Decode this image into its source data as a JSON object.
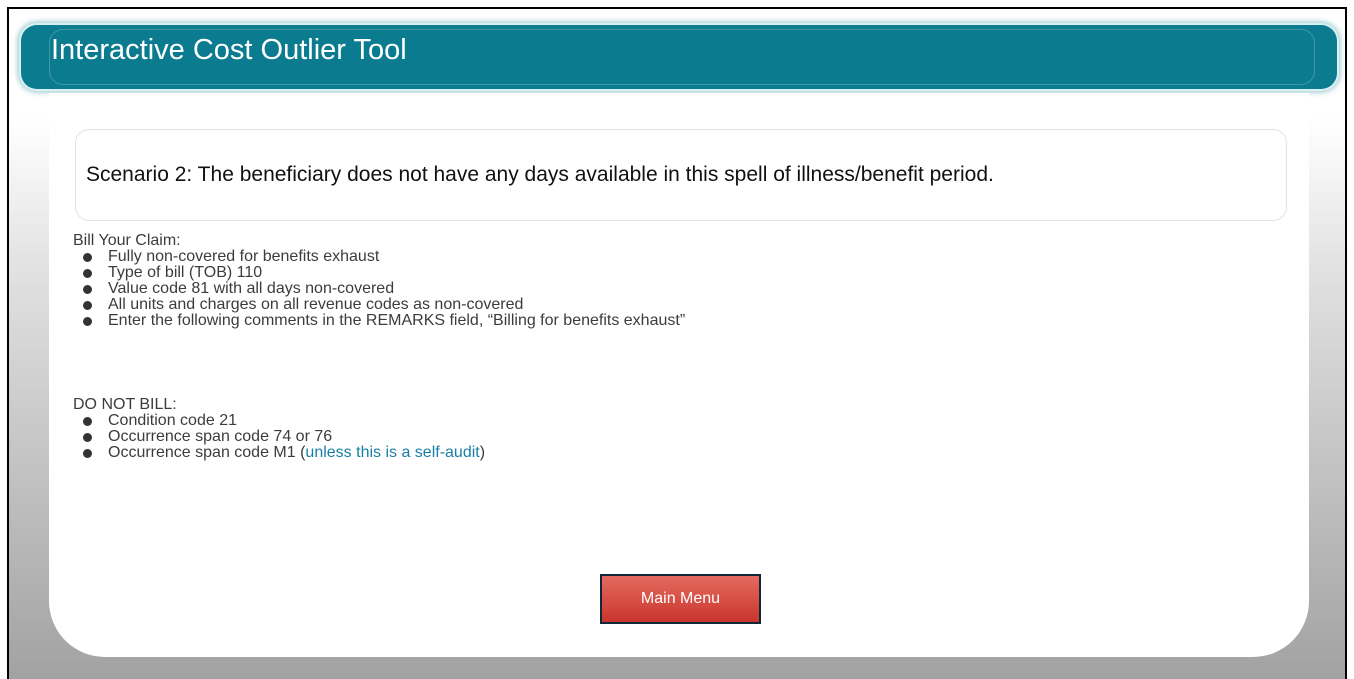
{
  "header": {
    "title": "Interactive Cost Outlier Tool"
  },
  "scenario": {
    "text": "Scenario 2: The beneficiary does not have any days available in this spell of illness/benefit period."
  },
  "bill_claim": {
    "heading": "Bill Your Claim:",
    "items": [
      "Fully non-covered for benefits exhaust",
      "Type of bill (TOB) 110",
      "Value code 81 with all days non-covered",
      "All units and charges on all revenue codes as non-covered",
      "Enter the following comments in the REMARKS field, “Billing for benefits exhaust”"
    ]
  },
  "do_not_bill": {
    "heading": "DO NOT BILL:",
    "items": [
      "Condition code 21",
      "Occurrence span code 74 or 76"
    ],
    "last_item": {
      "prefix": "Occurrence span code M1 (",
      "link": "unless this is a self-audit",
      "suffix": ")"
    }
  },
  "buttons": {
    "main_menu": "Main Menu"
  },
  "colors": {
    "header_bg": "#0b7b8f",
    "link": "#1a7fa4",
    "button_bg": "#d7473e",
    "button_border": "#102838"
  }
}
